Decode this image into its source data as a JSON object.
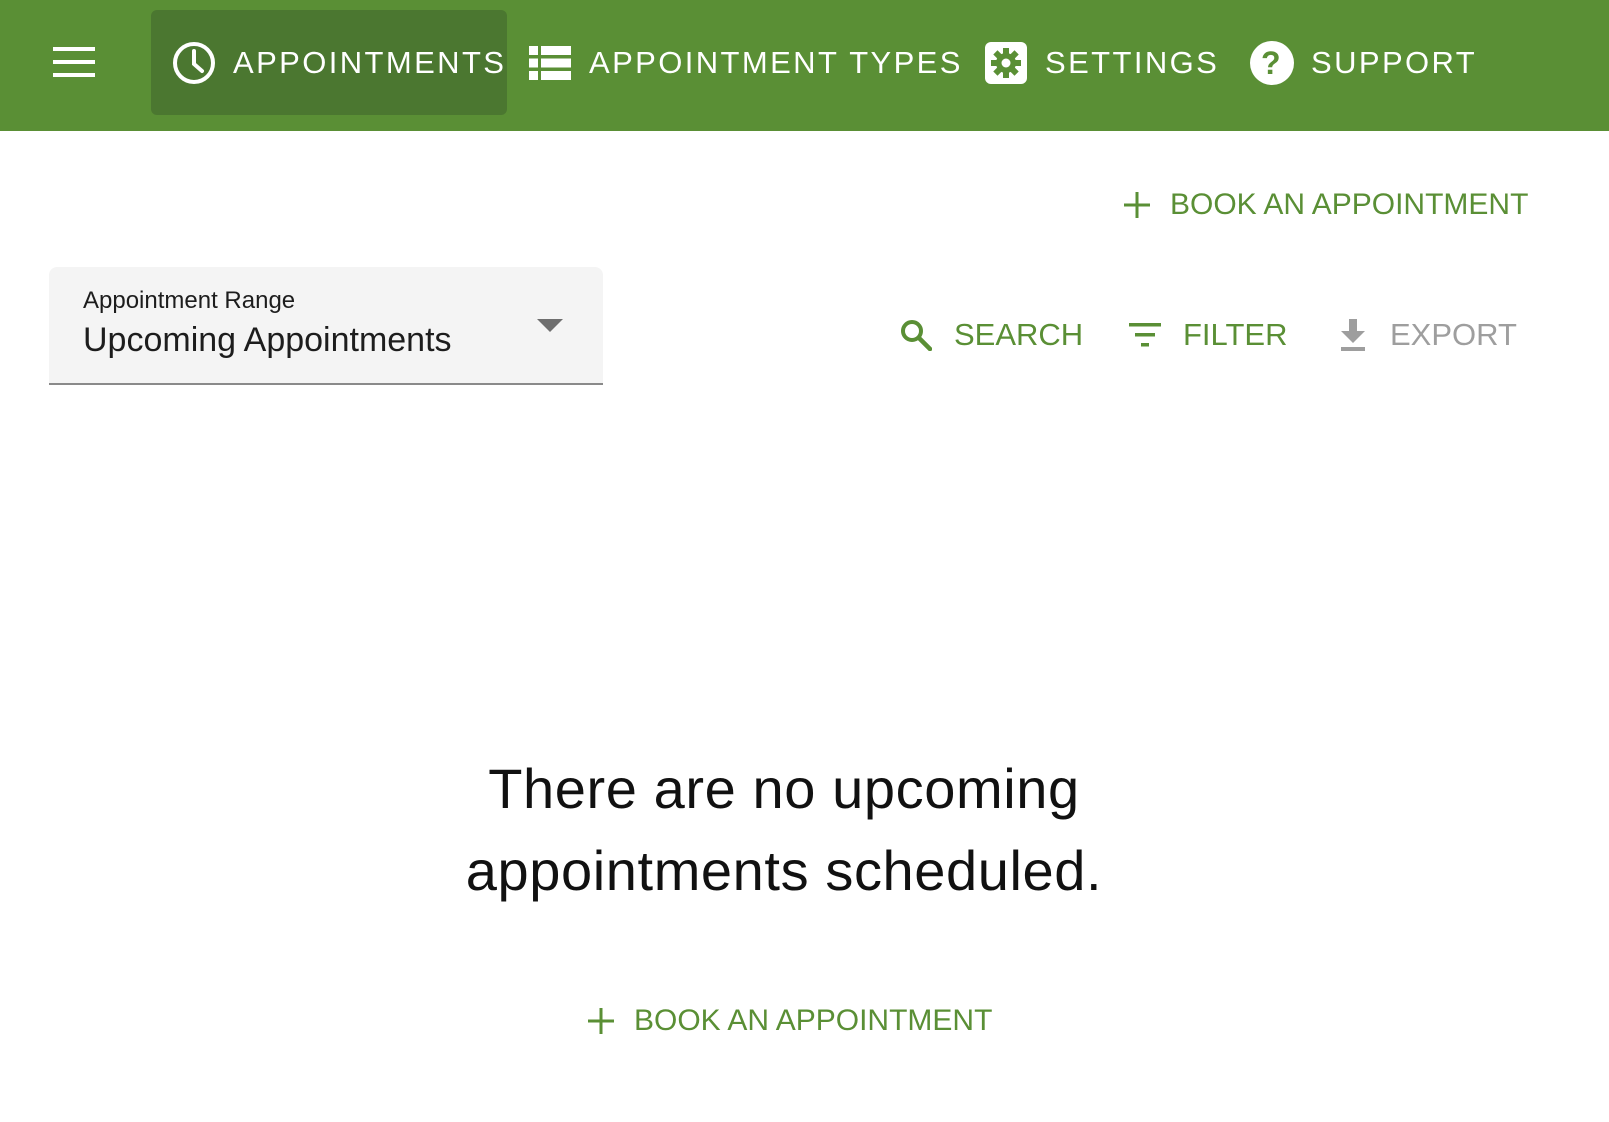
{
  "header": {
    "background_color": "#5a8f35",
    "active_tab_color": "#4b7730",
    "menu_icon": "hamburger-menu-icon",
    "tabs": [
      {
        "label": "APPOINTMENTS",
        "icon": "clock-icon",
        "active": true
      },
      {
        "label": "APPOINTMENT TYPES",
        "icon": "list-icon",
        "active": false
      },
      {
        "label": "SETTINGS",
        "icon": "gear-icon",
        "active": false
      },
      {
        "label": "SUPPORT",
        "icon": "help-circle-icon",
        "active": false
      }
    ]
  },
  "actions": {
    "book_top_label": "BOOK AN APPOINTMENT",
    "book_bottom_label": "BOOK AN APPOINTMENT",
    "accent_color": "#5a8f35"
  },
  "range_select": {
    "label": "Appointment Range",
    "value": "Upcoming Appointments"
  },
  "toolbar": {
    "search_label": "SEARCH",
    "filter_label": "FILTER",
    "export_label": "EXPORT",
    "export_disabled": true
  },
  "empty_state": {
    "line1": "There are no upcoming",
    "line2": "appointments scheduled."
  }
}
